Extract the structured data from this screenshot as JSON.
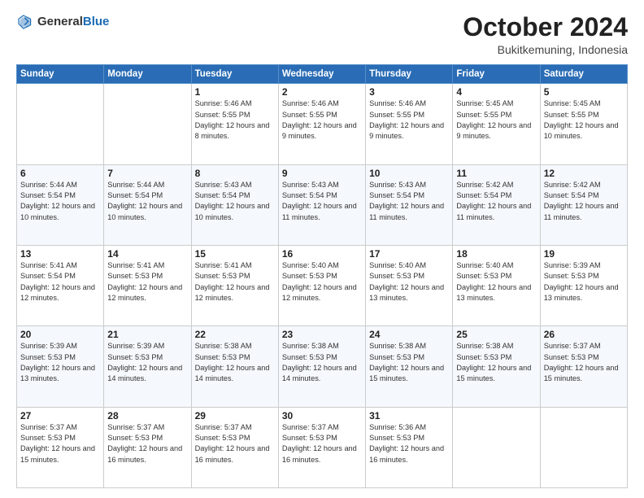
{
  "header": {
    "logo": {
      "general": "General",
      "blue": "Blue"
    },
    "title": "October 2024",
    "location": "Bukitkemuning, Indonesia"
  },
  "days_of_week": [
    "Sunday",
    "Monday",
    "Tuesday",
    "Wednesday",
    "Thursday",
    "Friday",
    "Saturday"
  ],
  "weeks": [
    [
      null,
      null,
      {
        "day": "1",
        "sunrise": "Sunrise: 5:46 AM",
        "sunset": "Sunset: 5:55 PM",
        "daylight": "Daylight: 12 hours and 8 minutes."
      },
      {
        "day": "2",
        "sunrise": "Sunrise: 5:46 AM",
        "sunset": "Sunset: 5:55 PM",
        "daylight": "Daylight: 12 hours and 9 minutes."
      },
      {
        "day": "3",
        "sunrise": "Sunrise: 5:46 AM",
        "sunset": "Sunset: 5:55 PM",
        "daylight": "Daylight: 12 hours and 9 minutes."
      },
      {
        "day": "4",
        "sunrise": "Sunrise: 5:45 AM",
        "sunset": "Sunset: 5:55 PM",
        "daylight": "Daylight: 12 hours and 9 minutes."
      },
      {
        "day": "5",
        "sunrise": "Sunrise: 5:45 AM",
        "sunset": "Sunset: 5:55 PM",
        "daylight": "Daylight: 12 hours and 10 minutes."
      }
    ],
    [
      {
        "day": "6",
        "sunrise": "Sunrise: 5:44 AM",
        "sunset": "Sunset: 5:54 PM",
        "daylight": "Daylight: 12 hours and 10 minutes."
      },
      {
        "day": "7",
        "sunrise": "Sunrise: 5:44 AM",
        "sunset": "Sunset: 5:54 PM",
        "daylight": "Daylight: 12 hours and 10 minutes."
      },
      {
        "day": "8",
        "sunrise": "Sunrise: 5:43 AM",
        "sunset": "Sunset: 5:54 PM",
        "daylight": "Daylight: 12 hours and 10 minutes."
      },
      {
        "day": "9",
        "sunrise": "Sunrise: 5:43 AM",
        "sunset": "Sunset: 5:54 PM",
        "daylight": "Daylight: 12 hours and 11 minutes."
      },
      {
        "day": "10",
        "sunrise": "Sunrise: 5:43 AM",
        "sunset": "Sunset: 5:54 PM",
        "daylight": "Daylight: 12 hours and 11 minutes."
      },
      {
        "day": "11",
        "sunrise": "Sunrise: 5:42 AM",
        "sunset": "Sunset: 5:54 PM",
        "daylight": "Daylight: 12 hours and 11 minutes."
      },
      {
        "day": "12",
        "sunrise": "Sunrise: 5:42 AM",
        "sunset": "Sunset: 5:54 PM",
        "daylight": "Daylight: 12 hours and 11 minutes."
      }
    ],
    [
      {
        "day": "13",
        "sunrise": "Sunrise: 5:41 AM",
        "sunset": "Sunset: 5:54 PM",
        "daylight": "Daylight: 12 hours and 12 minutes."
      },
      {
        "day": "14",
        "sunrise": "Sunrise: 5:41 AM",
        "sunset": "Sunset: 5:53 PM",
        "daylight": "Daylight: 12 hours and 12 minutes."
      },
      {
        "day": "15",
        "sunrise": "Sunrise: 5:41 AM",
        "sunset": "Sunset: 5:53 PM",
        "daylight": "Daylight: 12 hours and 12 minutes."
      },
      {
        "day": "16",
        "sunrise": "Sunrise: 5:40 AM",
        "sunset": "Sunset: 5:53 PM",
        "daylight": "Daylight: 12 hours and 12 minutes."
      },
      {
        "day": "17",
        "sunrise": "Sunrise: 5:40 AM",
        "sunset": "Sunset: 5:53 PM",
        "daylight": "Daylight: 12 hours and 13 minutes."
      },
      {
        "day": "18",
        "sunrise": "Sunrise: 5:40 AM",
        "sunset": "Sunset: 5:53 PM",
        "daylight": "Daylight: 12 hours and 13 minutes."
      },
      {
        "day": "19",
        "sunrise": "Sunrise: 5:39 AM",
        "sunset": "Sunset: 5:53 PM",
        "daylight": "Daylight: 12 hours and 13 minutes."
      }
    ],
    [
      {
        "day": "20",
        "sunrise": "Sunrise: 5:39 AM",
        "sunset": "Sunset: 5:53 PM",
        "daylight": "Daylight: 12 hours and 13 minutes."
      },
      {
        "day": "21",
        "sunrise": "Sunrise: 5:39 AM",
        "sunset": "Sunset: 5:53 PM",
        "daylight": "Daylight: 12 hours and 14 minutes."
      },
      {
        "day": "22",
        "sunrise": "Sunrise: 5:38 AM",
        "sunset": "Sunset: 5:53 PM",
        "daylight": "Daylight: 12 hours and 14 minutes."
      },
      {
        "day": "23",
        "sunrise": "Sunrise: 5:38 AM",
        "sunset": "Sunset: 5:53 PM",
        "daylight": "Daylight: 12 hours and 14 minutes."
      },
      {
        "day": "24",
        "sunrise": "Sunrise: 5:38 AM",
        "sunset": "Sunset: 5:53 PM",
        "daylight": "Daylight: 12 hours and 15 minutes."
      },
      {
        "day": "25",
        "sunrise": "Sunrise: 5:38 AM",
        "sunset": "Sunset: 5:53 PM",
        "daylight": "Daylight: 12 hours and 15 minutes."
      },
      {
        "day": "26",
        "sunrise": "Sunrise: 5:37 AM",
        "sunset": "Sunset: 5:53 PM",
        "daylight": "Daylight: 12 hours and 15 minutes."
      }
    ],
    [
      {
        "day": "27",
        "sunrise": "Sunrise: 5:37 AM",
        "sunset": "Sunset: 5:53 PM",
        "daylight": "Daylight: 12 hours and 15 minutes."
      },
      {
        "day": "28",
        "sunrise": "Sunrise: 5:37 AM",
        "sunset": "Sunset: 5:53 PM",
        "daylight": "Daylight: 12 hours and 16 minutes."
      },
      {
        "day": "29",
        "sunrise": "Sunrise: 5:37 AM",
        "sunset": "Sunset: 5:53 PM",
        "daylight": "Daylight: 12 hours and 16 minutes."
      },
      {
        "day": "30",
        "sunrise": "Sunrise: 5:37 AM",
        "sunset": "Sunset: 5:53 PM",
        "daylight": "Daylight: 12 hours and 16 minutes."
      },
      {
        "day": "31",
        "sunrise": "Sunrise: 5:36 AM",
        "sunset": "Sunset: 5:53 PM",
        "daylight": "Daylight: 12 hours and 16 minutes."
      },
      null,
      null
    ]
  ]
}
